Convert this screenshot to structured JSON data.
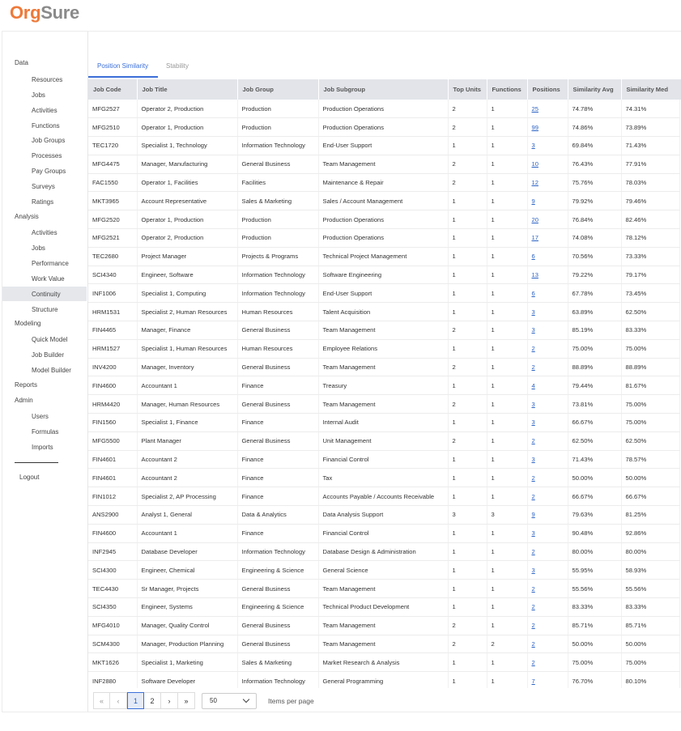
{
  "brand": {
    "part1": "Org",
    "part2": "Sure"
  },
  "sidebar": {
    "sections": [
      {
        "label": "Data",
        "items": [
          "Resources",
          "Jobs",
          "Activities",
          "Functions",
          "Job Groups",
          "Processes",
          "Pay Groups",
          "Surveys",
          "Ratings"
        ]
      },
      {
        "label": "Analysis",
        "items": [
          "Activities",
          "Jobs",
          "Performance",
          "Work Value",
          "Continuity",
          "Structure"
        ]
      },
      {
        "label": "Modeling",
        "items": [
          "Quick Model",
          "Job Builder",
          "Model Builder"
        ]
      },
      {
        "label": "Reports",
        "items": []
      },
      {
        "label": "Admin",
        "items": [
          "Users",
          "Formulas",
          "Imports"
        ]
      }
    ],
    "active_item": "Continuity",
    "logout": "Logout"
  },
  "tabs": [
    {
      "label": "Position Similarity",
      "active": true
    },
    {
      "label": "Stability",
      "active": false
    }
  ],
  "table": {
    "columns": [
      "Job Code",
      "Job Title",
      "Job Group",
      "Job Subgroup",
      "Top Units",
      "Functions",
      "Positions",
      "Similarity Avg",
      "Similarity Med"
    ],
    "rows": [
      [
        "MFG2527",
        "Operator 2, Production",
        "Production",
        "Production Operations",
        "2",
        "1",
        "25",
        "74.78%",
        "74.31%"
      ],
      [
        "MFG2510",
        "Operator 1, Production",
        "Production",
        "Production Operations",
        "2",
        "1",
        "99",
        "74.86%",
        "73.89%"
      ],
      [
        "TEC1720",
        "Specialist 1, Technology",
        "Information Technology",
        "End-User Support",
        "1",
        "1",
        "3",
        "69.84%",
        "71.43%"
      ],
      [
        "MFG4475",
        "Manager, Manufacturing",
        "General Business",
        "Team Management",
        "2",
        "1",
        "10",
        "76.43%",
        "77.91%"
      ],
      [
        "FAC1550",
        "Operator 1, Facilities",
        "Facilities",
        "Maintenance & Repair",
        "2",
        "1",
        "12",
        "75.76%",
        "78.03%"
      ],
      [
        "MKT3965",
        "Account Representative",
        "Sales & Marketing",
        "Sales / Account Management",
        "1",
        "1",
        "9",
        "79.92%",
        "79.46%"
      ],
      [
        "MFG2520",
        "Operator 1, Production",
        "Production",
        "Production Operations",
        "1",
        "1",
        "20",
        "76.84%",
        "82.46%"
      ],
      [
        "MFG2521",
        "Operator 2, Production",
        "Production",
        "Production Operations",
        "1",
        "1",
        "17",
        "74.08%",
        "78.12%"
      ],
      [
        "TEC2680",
        "Project Manager",
        "Projects & Programs",
        "Technical Project Management",
        "1",
        "1",
        "6",
        "70.56%",
        "73.33%"
      ],
      [
        "SCI4340",
        "Engineer, Software",
        "Information Technology",
        "Software Engineering",
        "1",
        "1",
        "13",
        "79.22%",
        "79.17%"
      ],
      [
        "INF1006",
        "Specialist 1, Computing",
        "Information Technology",
        "End-User Support",
        "1",
        "1",
        "6",
        "67.78%",
        "73.45%"
      ],
      [
        "HRM1531",
        "Specialist 2, Human Resources",
        "Human Resources",
        "Talent Acquisition",
        "1",
        "1",
        "3",
        "63.89%",
        "62.50%"
      ],
      [
        "FIN4465",
        "Manager, Finance",
        "General Business",
        "Team Management",
        "2",
        "1",
        "3",
        "85.19%",
        "83.33%"
      ],
      [
        "HRM1527",
        "Specialist 1, Human Resources",
        "Human Resources",
        "Employee Relations",
        "1",
        "1",
        "2",
        "75.00%",
        "75.00%"
      ],
      [
        "INV4200",
        "Manager, Inventory",
        "General Business",
        "Team Management",
        "2",
        "1",
        "2",
        "88.89%",
        "88.89%"
      ],
      [
        "FIN4600",
        "Accountant 1",
        "Finance",
        "Treasury",
        "1",
        "1",
        "4",
        "79.44%",
        "81.67%"
      ],
      [
        "HRM4420",
        "Manager, Human Resources",
        "General Business",
        "Team Management",
        "2",
        "1",
        "3",
        "73.81%",
        "75.00%"
      ],
      [
        "FIN1560",
        "Specialist 1, Finance",
        "Finance",
        "Internal Audit",
        "1",
        "1",
        "3",
        "66.67%",
        "75.00%"
      ],
      [
        "MFG5500",
        "Plant Manager",
        "General Business",
        "Unit Management",
        "2",
        "1",
        "2",
        "62.50%",
        "62.50%"
      ],
      [
        "FIN4601",
        "Accountant 2",
        "Finance",
        "Financial Control",
        "1",
        "1",
        "3",
        "71.43%",
        "78.57%"
      ],
      [
        "FIN4601",
        "Accountant 2",
        "Finance",
        "Tax",
        "1",
        "1",
        "2",
        "50.00%",
        "50.00%"
      ],
      [
        "FIN1012",
        "Specialist 2, AP Processing",
        "Finance",
        "Accounts Payable / Accounts Receivable",
        "1",
        "1",
        "2",
        "66.67%",
        "66.67%"
      ],
      [
        "ANS2900",
        "Analyst 1, General",
        "Data & Analytics",
        "Data Analysis Support",
        "3",
        "3",
        "9",
        "79.63%",
        "81.25%"
      ],
      [
        "FIN4600",
        "Accountant 1",
        "Finance",
        "Financial Control",
        "1",
        "1",
        "3",
        "90.48%",
        "92.86%"
      ],
      [
        "INF2945",
        "Database Developer",
        "Information Technology",
        "Database Design & Administration",
        "1",
        "1",
        "2",
        "80.00%",
        "80.00%"
      ],
      [
        "SCI4300",
        "Engineer, Chemical",
        "Engineering & Science",
        "General Science",
        "1",
        "1",
        "3",
        "55.95%",
        "58.93%"
      ],
      [
        "TEC4430",
        "Sr Manager, Projects",
        "General Business",
        "Team Management",
        "1",
        "1",
        "2",
        "55.56%",
        "55.56%"
      ],
      [
        "SCI4350",
        "Engineer, Systems",
        "Engineering & Science",
        "Technical Product Development",
        "1",
        "1",
        "2",
        "83.33%",
        "83.33%"
      ],
      [
        "MFG4010",
        "Manager, Quality Control",
        "General Business",
        "Team Management",
        "2",
        "1",
        "2",
        "85.71%",
        "85.71%"
      ],
      [
        "SCM4300",
        "Manager, Production Planning",
        "General Business",
        "Team Management",
        "2",
        "2",
        "2",
        "50.00%",
        "50.00%"
      ],
      [
        "MKT1626",
        "Specialist 1, Marketing",
        "Sales & Marketing",
        "Market Research & Analysis",
        "1",
        "1",
        "2",
        "75.00%",
        "75.00%"
      ],
      [
        "INF2880",
        "Software Developer",
        "Information Technology",
        "General Programming",
        "1",
        "1",
        "7",
        "76.70%",
        "80.10%"
      ]
    ]
  },
  "pagination": {
    "first": "«",
    "prev": "‹",
    "pages": [
      "1",
      "2"
    ],
    "current": "1",
    "next": "›",
    "last": "»",
    "per_page_value": "50",
    "per_page_label": "Items per page"
  }
}
